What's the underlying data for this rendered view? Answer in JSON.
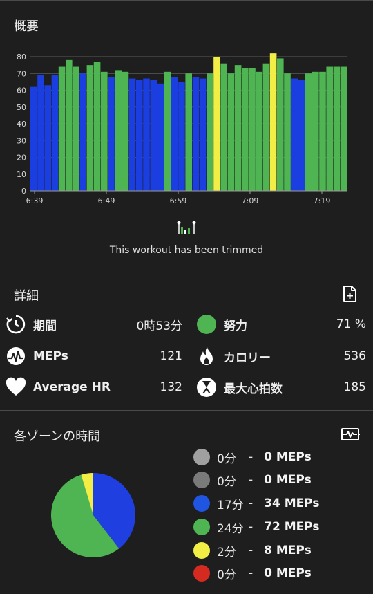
{
  "overview": {
    "title": "概要",
    "trim_text": "This workout has been trimmed"
  },
  "chart_data": {
    "type": "bar",
    "y_ticks": [
      "0",
      "10",
      "20",
      "30",
      "40",
      "50",
      "60",
      "70",
      "80"
    ],
    "ylim": [
      0,
      80
    ],
    "x_ticks": [
      "6:39",
      "6:49",
      "6:59",
      "7:09",
      "7:19"
    ],
    "values": [
      62,
      69,
      63,
      69,
      74,
      78,
      74,
      70,
      75,
      77,
      71,
      68,
      72,
      71,
      67,
      66,
      67,
      66,
      64,
      71,
      68,
      65,
      70,
      68,
      67,
      70,
      80,
      76,
      70,
      75,
      73,
      73,
      71,
      76,
      82,
      79,
      70,
      67,
      66,
      70,
      71,
      71,
      74,
      74,
      74
    ],
    "zones": [
      "blue",
      "blue",
      "blue",
      "blue",
      "green",
      "green",
      "green",
      "blue",
      "green",
      "green",
      "green",
      "blue",
      "green",
      "green",
      "blue",
      "blue",
      "blue",
      "blue",
      "blue",
      "green",
      "blue",
      "blue",
      "green",
      "blue",
      "blue",
      "green",
      "yellow",
      "green",
      "green",
      "green",
      "green",
      "green",
      "green",
      "green",
      "yellow",
      "green",
      "green",
      "blue",
      "blue",
      "green",
      "green",
      "green",
      "green",
      "green",
      "green"
    ],
    "colors": {
      "blue": "#1a3ee0",
      "green": "#4fb553",
      "yellow": "#f3ee45"
    }
  },
  "details": {
    "title": "詳細",
    "stats": [
      {
        "icon": "timer-icon",
        "label": "期間",
        "value": "0時53分"
      },
      {
        "icon": "effort-dot-icon",
        "label": "努力",
        "value": "71 %"
      },
      {
        "icon": "meps-icon",
        "label": "MEPs",
        "value": "121"
      },
      {
        "icon": "flame-icon",
        "label": "カロリー",
        "value": "536"
      },
      {
        "icon": "heart-icon",
        "label": "Average HR",
        "value": "132"
      },
      {
        "icon": "hourglass-icon",
        "label": "最大心拍数",
        "value": "185"
      }
    ]
  },
  "zones": {
    "title": "各ゾーンの時間",
    "items": [
      {
        "color": "#a0a0a0",
        "minutes": "0分",
        "sep": "-",
        "meps": "0 MEPs"
      },
      {
        "color": "#7a7a7a",
        "minutes": "0分",
        "sep": "-",
        "meps": "0 MEPs"
      },
      {
        "color": "#1f55e0",
        "minutes": "17分",
        "sep": "-",
        "meps": "34 MEPs"
      },
      {
        "color": "#4fb553",
        "minutes": "24分",
        "sep": "-",
        "meps": "72 MEPs"
      },
      {
        "color": "#f3ee45",
        "minutes": "2分",
        "sep": "-",
        "meps": "8 MEPs"
      },
      {
        "color": "#d42a20",
        "minutes": "0分",
        "sep": "-",
        "meps": "0 MEPs"
      }
    ],
    "pie": [
      {
        "label": "blue",
        "value": 17,
        "color": "#1f3fe0"
      },
      {
        "label": "green",
        "value": 24,
        "color": "#4fb553"
      },
      {
        "label": "yellow",
        "value": 2,
        "color": "#f3ee45"
      }
    ]
  }
}
